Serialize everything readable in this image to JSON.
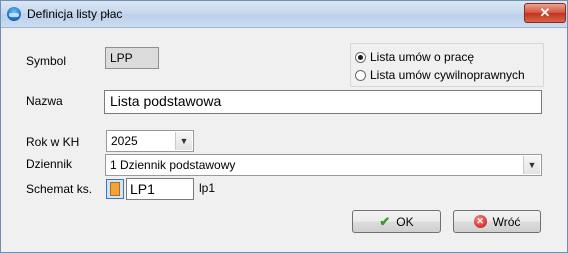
{
  "window": {
    "title": "Definicja listy płac",
    "close_glyph": "✕"
  },
  "symbol": {
    "label": "Symbol",
    "value": "LPP"
  },
  "list_type": {
    "options": [
      {
        "label": "Lista umów o pracę",
        "selected": true
      },
      {
        "label": "Lista umów cywilnoprawnych",
        "selected": false
      }
    ]
  },
  "nazwa": {
    "label": "Nazwa",
    "value": "Lista podstawowa"
  },
  "rok": {
    "label": "Rok w KH",
    "value": "2025"
  },
  "dziennik": {
    "label": "Dziennik",
    "value": "1  Dziennik podstawowy"
  },
  "schemat": {
    "label": "Schemat ks.",
    "value": "LP1",
    "description": "lp1"
  },
  "buttons": {
    "ok_label": "OK",
    "cancel_label": "Wróć"
  },
  "icons": {
    "dropdown": "chevron-down-icon",
    "ok": "checkmark-icon",
    "cancel": "cancel-icon",
    "schemat": "document-picker-icon"
  }
}
